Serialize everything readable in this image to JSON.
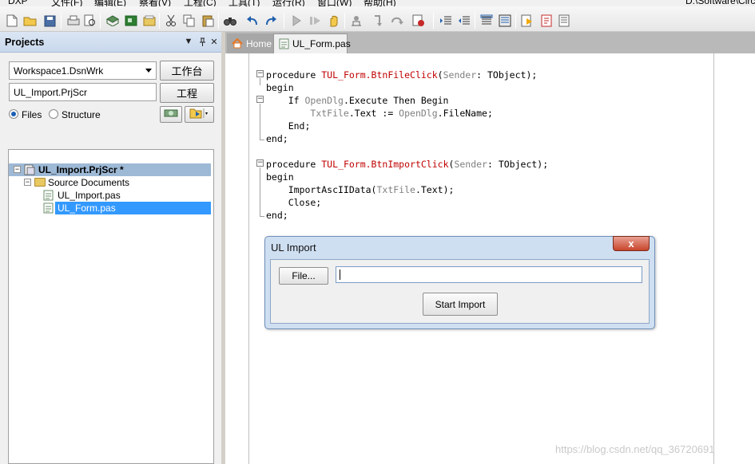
{
  "menubar": {
    "items": [
      "DXP",
      "文件(F)",
      "编辑(E)",
      "察看(V)",
      "工程(C)",
      "工具(T)",
      "运行(R)",
      "窗口(W)",
      "帮助(H)"
    ],
    "path": "D:\\Software\\Circ"
  },
  "projects_panel": {
    "title": "Projects",
    "workspace": "Workspace1.DsnWrk",
    "workspace_button": "工作台",
    "project": "UL_Import.PrjScr",
    "project_button": "工程",
    "view_files": "Files",
    "view_structure": "Structure",
    "tree": {
      "project": "UL_Import.PrjScr *",
      "folder": "Source Documents",
      "files": [
        "UL_Import.pas",
        "UL_Form.pas"
      ]
    }
  },
  "tabs": [
    {
      "label": "Home"
    },
    {
      "label": "UL_Form.pas"
    }
  ],
  "code": {
    "l1": [
      "procedure ",
      "TUL_Form.BtnFileClick",
      "(",
      "Sender",
      ": TObject);"
    ],
    "l2": "begin",
    "l3": [
      "    If ",
      "OpenDlg",
      ".Execute Then Begin"
    ],
    "l4": [
      "        ",
      "TxtFile",
      ".Text := ",
      "OpenDlg",
      ".FileName;"
    ],
    "l5": "    End;",
    "l6": "end;",
    "l8": [
      "procedure ",
      "TUL_Form.BtnImportClick",
      "(",
      "Sender",
      ": TObject);"
    ],
    "l9": "begin",
    "l10": [
      "    ImportAscIIData(",
      "TxtFile",
      ".Text);"
    ],
    "l11": "    Close;",
    "l12": "end;"
  },
  "dialog": {
    "title": "UL Import",
    "close": "x",
    "file_button": "File...",
    "file_value": "",
    "start_button": "Start Import"
  },
  "watermark": "https://blog.csdn.net/qq_36720691"
}
